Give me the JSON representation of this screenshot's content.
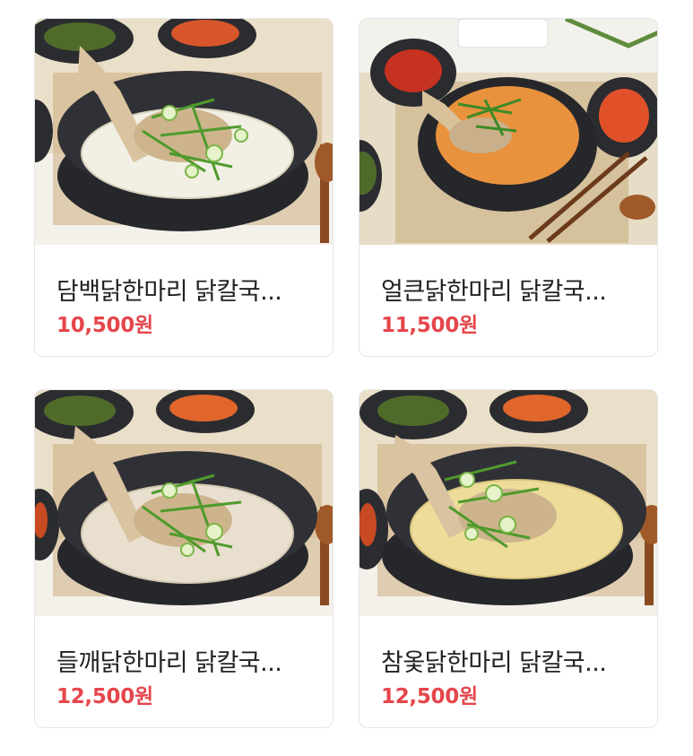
{
  "products": [
    {
      "name": "담백닭한마리 닭칼국...",
      "price": "10,500원",
      "image_icon": "food-photo-icon"
    },
    {
      "name": "얼큰닭한마리 닭칼국...",
      "price": "11,500원",
      "image_icon": "food-photo-icon"
    },
    {
      "name": "들깨닭한마리 닭칼국...",
      "price": "12,500원",
      "image_icon": "food-photo-icon"
    },
    {
      "name": "참옻닭한마리 닭칼국...",
      "price": "12,500원",
      "image_icon": "food-photo-icon"
    }
  ],
  "colors": {
    "price": "#e5464c",
    "title": "#222222",
    "card_border": "#e6e6e6",
    "broth_clear": "#f2efe4",
    "broth_spicy": "#e9923e",
    "broth_perilla": "#e8dfcf",
    "broth_lacquer": "#eedc9a"
  }
}
